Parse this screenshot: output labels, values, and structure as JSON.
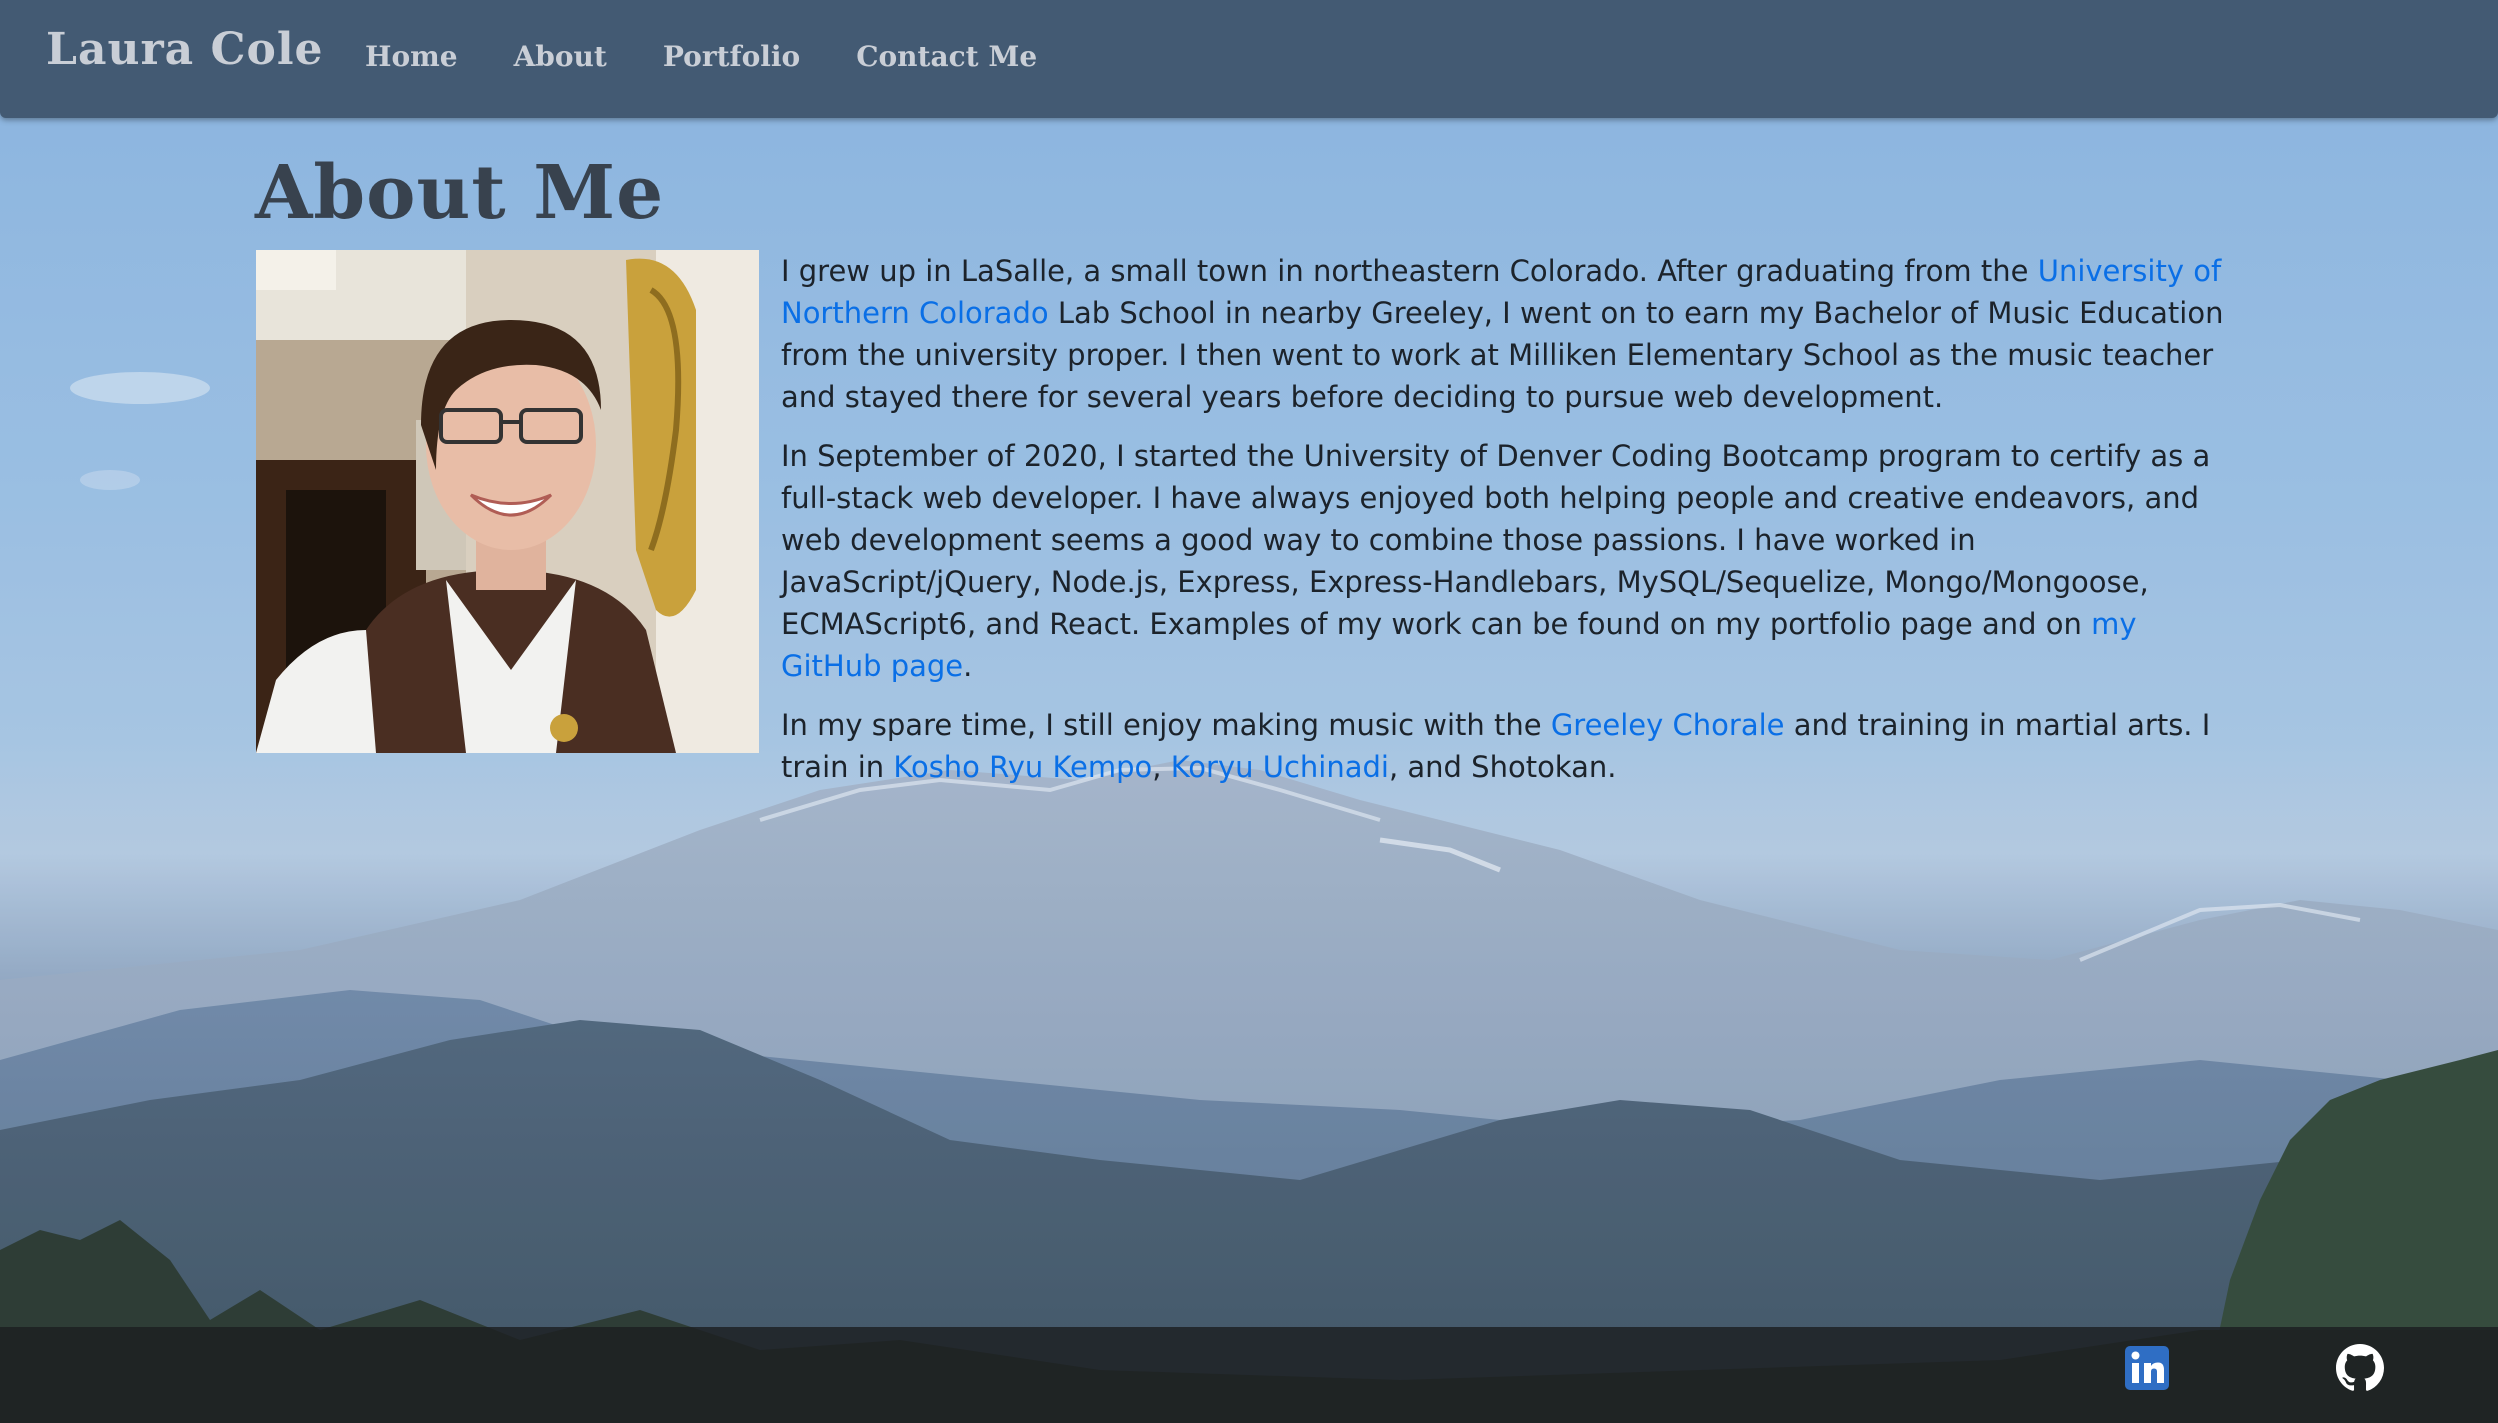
{
  "navbar": {
    "brand": "Laura Cole",
    "links": [
      "Home",
      "About",
      "Portfolio",
      "Contact Me"
    ]
  },
  "main": {
    "title": "About Me",
    "portrait_alt": "Photo of Laura Cole",
    "bio": {
      "p1": {
        "t1": "I grew up in LaSalle, a small town in northeastern Colorado. After graduating from the ",
        "link1": "University of Northern Colorado",
        "t2": " Lab School in nearby Greeley, I went on to earn my Bachelor of Music Education from the university proper. I then went to work at Milliken Elementary School as the music teacher and stayed there for several years before deciding to pursue web development."
      },
      "p2": {
        "t1": "In September of 2020, I started the University of Denver Coding Bootcamp program to certify as a full-stack web developer. I have always enjoyed both helping people and creative endeavors, and web development seems a good way to combine those passions. I have worked in JavaScript/jQuery, Node.js, Express, Express-Handlebars, MySQL/Sequelize, Mongo/Mongoose, ECMAScript6, and React. Examples of my work can be found on my portfolio page and on ",
        "link1": "my GitHub page",
        "t2": "."
      },
      "p3": {
        "t1": "In my spare time, I still enjoy making music with the ",
        "link1": "Greeley Chorale",
        "t2": " and training in martial arts. I train in ",
        "link2": "Kosho Ryu Kempo",
        "t3": ", ",
        "link3": "Koryu Uchinadi",
        "t4": ", and Shotokan."
      }
    }
  },
  "footer": {
    "icons": [
      "linkedin-icon",
      "github-icon"
    ]
  },
  "colors": {
    "navbar_bg": "#435a73",
    "link": "#0a6fe6",
    "text": "#1c232b",
    "footer_bg": "#1c1e21"
  }
}
